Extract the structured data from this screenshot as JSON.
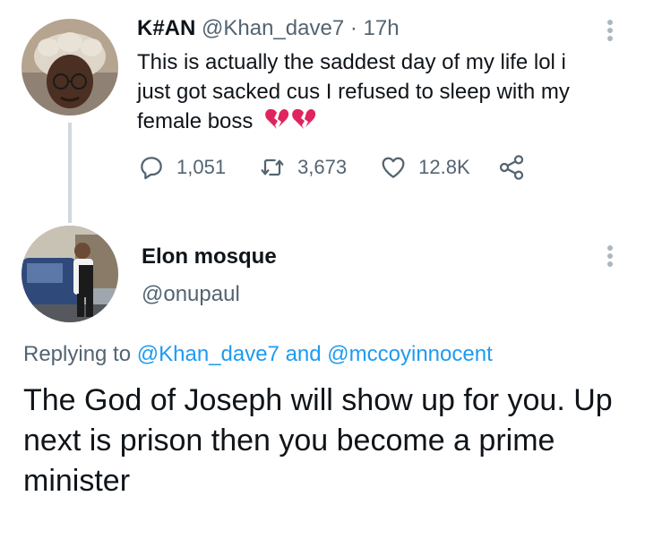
{
  "tweet": {
    "author_name": "K#AN",
    "author_handle": "@Khan_dave7",
    "time": "· 17h",
    "text": "This is actually the saddest day of my life lol i just got sacked cus I refused to sleep with my female boss",
    "emoji": "💔💔",
    "stats": {
      "replies": "1,051",
      "retweets": "3,673",
      "likes": "12.8K"
    }
  },
  "reply": {
    "author_name": "Elon mosque",
    "author_handle": "@onupaul",
    "replying_prefix": "Replying to",
    "replying_user1": "@Khan_dave7",
    "replying_and": "and",
    "replying_user2": "@mccoyinnocent",
    "text": "The God of Joseph will show up for you. Up next is prison then you become a prime minister"
  },
  "colors": {
    "accent": "#1d9bf0",
    "secondary_text": "#536471",
    "primary_text": "#0f1419",
    "thread_line": "#cfd9de",
    "broken_heart": "#e0245e"
  }
}
